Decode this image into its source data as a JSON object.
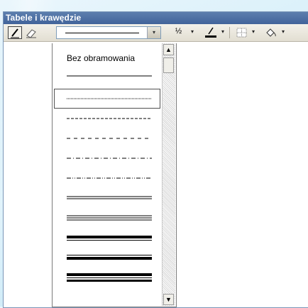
{
  "toolbar": {
    "title": "Tabele i krawędzie",
    "line_weight": "½",
    "pen_icon": "pen-icon",
    "eraser_icon": "eraser-icon",
    "border_color_icon": "pen-color-icon",
    "borders_icon": "borders-icon",
    "fill_icon": "paint-bucket-icon",
    "dropdown_arrow": "▾"
  },
  "line_style_list": {
    "items": [
      {
        "label": "Bez obramowania",
        "style": "none"
      },
      {
        "label": "",
        "style": "solid"
      },
      {
        "label": "",
        "style": "dotted",
        "selected": true
      },
      {
        "label": "",
        "style": "dashed-short"
      },
      {
        "label": "",
        "style": "dashed"
      },
      {
        "label": "",
        "style": "dash-dot"
      },
      {
        "label": "",
        "style": "dash-dot-dot"
      },
      {
        "label": "",
        "style": "double"
      },
      {
        "label": "",
        "style": "triple"
      },
      {
        "label": "",
        "style": "thick-thin"
      },
      {
        "label": "",
        "style": "thin-thick"
      },
      {
        "label": "",
        "style": "thick-thin-thick"
      }
    ]
  },
  "scrollbar": {
    "up": "▲",
    "down": "▼"
  },
  "colors": {
    "titlebar": "#41639a",
    "accent_red": "#ff0000"
  }
}
